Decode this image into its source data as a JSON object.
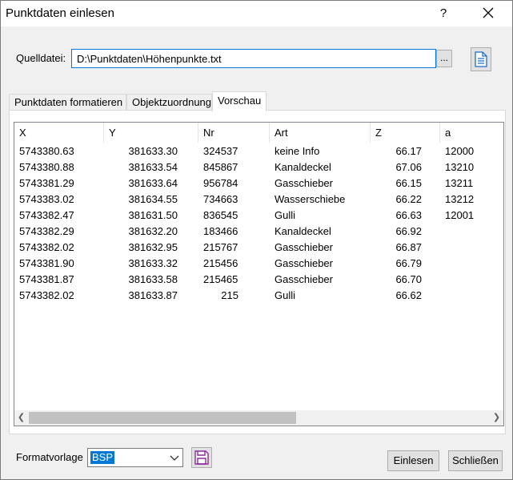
{
  "window": {
    "title": "Punktdaten einlesen",
    "help": "?"
  },
  "source": {
    "label": "Quelldatei:",
    "value": "D:\\Punktdaten\\Höhenpunkte.txt",
    "browse_label": "..."
  },
  "tabs": [
    {
      "label": "Punktdaten formatieren"
    },
    {
      "label": "Objektzuordnung"
    },
    {
      "label": "Vorschau",
      "active": true
    }
  ],
  "table": {
    "columns": [
      "X",
      "Y",
      "Nr",
      "Art",
      "Z",
      "a"
    ],
    "rows": [
      [
        "5743380.63",
        "381633.30",
        "324537",
        "keine Info",
        "66.17",
        "12000"
      ],
      [
        "5743380.88",
        "381633.54",
        "845867",
        "Kanaldeckel",
        "67.06",
        "13210"
      ],
      [
        "5743381.29",
        "381633.64",
        "956784",
        "Gasschieber",
        "66.15",
        "13211"
      ],
      [
        "5743383.02",
        "381634.55",
        "734663",
        "Wasserschiebe",
        "66.22",
        "13212"
      ],
      [
        "5743382.47",
        "381631.50",
        "836545",
        "Gulli",
        "66.63",
        "12001"
      ],
      [
        "5743382.29",
        "381632.20",
        "183466",
        "Kanaldeckel",
        "66.92",
        ""
      ],
      [
        "5743382.02",
        "381632.95",
        "215767",
        "Gasschieber",
        "66.87",
        ""
      ],
      [
        "5743381.90",
        "381633.32",
        "215456",
        "Gasschieber",
        "66.79",
        ""
      ],
      [
        "5743381.87",
        "381633.58",
        "215465",
        "Gasschieber",
        "66.70",
        ""
      ],
      [
        "5743382.02",
        "381633.87",
        "215",
        "Gulli",
        "66.62",
        ""
      ]
    ]
  },
  "format": {
    "label": "Formatvorlage",
    "selected": "BSP"
  },
  "buttons": {
    "read": "Einlesen",
    "close": "Schließen"
  },
  "icons": {
    "close": "close-icon",
    "document": "document-icon",
    "save": "floppy-disk-icon",
    "dropdown": "chevron-down-icon"
  }
}
